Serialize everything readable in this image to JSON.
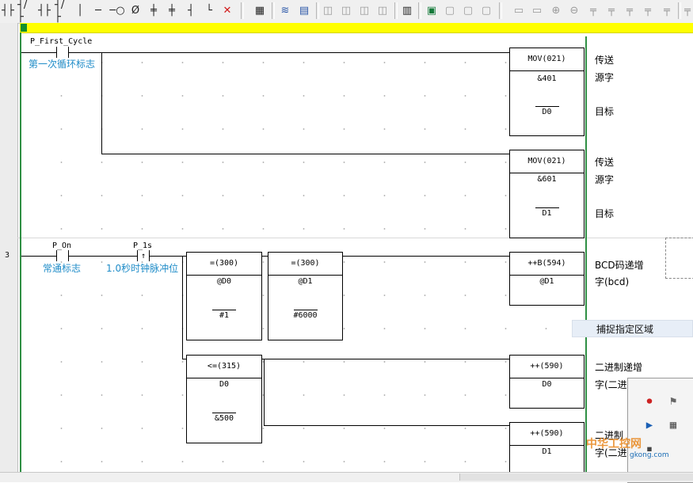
{
  "toolbar": {
    "icons": [
      "contact-no",
      "contact-nc",
      "contact-or-no",
      "contact-or-nc",
      "vertical-line",
      "horizontal-line",
      "coil",
      "coil-nc",
      "up-diff-contact",
      "down-diff-contact",
      "parallel-icon",
      "corner-icon",
      "delete-icon",
      "edit-icon",
      "db-icon",
      "book-icon",
      "compile-icon",
      "toggle-a",
      "toggle-b",
      "toggle-c",
      "monitor-icon",
      "monitor-a",
      "monitor-b",
      "monitor-c",
      "grid-a",
      "grid-b",
      "grid-c",
      "grid-d",
      "grid-e",
      "grid-f",
      "grid-g"
    ]
  },
  "rungs": [
    {
      "number": "",
      "contact": {
        "variable": "P_First_Cycle",
        "comment": "第一次循环标志"
      },
      "blocks": [
        {
          "op": "MOV(021)",
          "operands": [
            "&401",
            "D0"
          ],
          "side": [
            "传送",
            "源字",
            "目标"
          ]
        },
        {
          "op": "MOV(021)",
          "operands": [
            "&601",
            "D1"
          ],
          "side": [
            "传送",
            "源字",
            "目标"
          ]
        }
      ]
    },
    {
      "number": "3",
      "contacts": [
        {
          "variable": "P_On",
          "comment": "常通标志"
        },
        {
          "variable": "P_1s",
          "comment": "1.0秒时钟脉冲位"
        }
      ],
      "compare_blocks": [
        {
          "op": "=(300)",
          "operands": [
            "@D0",
            "#1"
          ]
        },
        {
          "op": "=(300)",
          "operands": [
            "@D1",
            "#6000"
          ]
        },
        {
          "op": "<=(315)",
          "operands": [
            "D0",
            "&500"
          ]
        }
      ],
      "output_blocks": [
        {
          "op": "++B(594)",
          "operands": [
            "@D1"
          ],
          "side": [
            "BCD码递增",
            "字(bcd)"
          ]
        },
        {
          "op": "++(590)",
          "operands": [
            "D0"
          ],
          "side": [
            "二进制递增",
            "字(二进"
          ]
        },
        {
          "op": "++(590)",
          "operands": [
            "D1"
          ],
          "side": [
            "二进制",
            "字(二进"
          ]
        }
      ]
    }
  ],
  "popup": {
    "capture_label": "捕捉指定区域"
  },
  "watermark": {
    "text": "中华工控网",
    "url": "gkong.com"
  }
}
